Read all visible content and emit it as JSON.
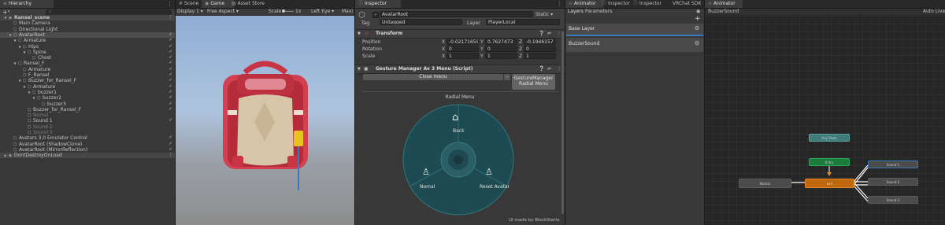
{
  "hierarchy": {
    "tab": "Hierarchy",
    "add": "+",
    "items": [
      {
        "label": "Ransel_scene",
        "icon": "◈",
        "check": "",
        "muted": false,
        "bold": true,
        "arrow": "▼",
        "indent": 0
      },
      {
        "label": "Main Camera",
        "icon": "⬡",
        "check": "",
        "muted": false,
        "bold": false,
        "arrow": "",
        "indent": 1
      },
      {
        "label": "Directional Light",
        "icon": "⬡",
        "check": "",
        "muted": false,
        "bold": false,
        "arrow": "",
        "indent": 1
      },
      {
        "label": "AvatarRoot",
        "icon": "⬡",
        "check": "✓",
        "muted": false,
        "bold": false,
        "arrow": "▼",
        "indent": 1,
        "selected": true
      },
      {
        "label": "Armature",
        "icon": "⬡",
        "check": "✓",
        "muted": false,
        "bold": false,
        "arrow": "▼",
        "indent": 2
      },
      {
        "label": "Hips",
        "icon": "⬡",
        "check": "✓",
        "muted": false,
        "bold": false,
        "arrow": "▼",
        "indent": 3
      },
      {
        "label": "Spine",
        "icon": "⬡",
        "check": "✓",
        "muted": false,
        "bold": false,
        "arrow": "▼",
        "indent": 4
      },
      {
        "label": "Chest",
        "icon": "⬡",
        "check": "✓",
        "muted": false,
        "bold": false,
        "arrow": "",
        "indent": 5
      },
      {
        "label": "Ransel_F",
        "icon": "⬡",
        "check": "✓",
        "muted": false,
        "bold": false,
        "arrow": "▼",
        "indent": 2
      },
      {
        "label": "Armature",
        "icon": "⬡",
        "check": "✓",
        "muted": false,
        "bold": false,
        "arrow": "",
        "indent": 3
      },
      {
        "label": "F_Ransel",
        "icon": "⬡",
        "check": "✓",
        "muted": false,
        "bold": false,
        "arrow": "",
        "indent": 3
      },
      {
        "label": "Buzzer_for_Ransel_F",
        "icon": "⬡",
        "check": "✓",
        "muted": false,
        "bold": false,
        "arrow": "▼",
        "indent": 3
      },
      {
        "label": "Armature",
        "icon": "⬡",
        "check": "✓",
        "muted": false,
        "bold": false,
        "arrow": "▼",
        "indent": 4
      },
      {
        "label": "buzzer1",
        "icon": "⬡",
        "check": "✓",
        "muted": false,
        "bold": false,
        "arrow": "▼",
        "indent": 5
      },
      {
        "label": "buzzer2",
        "icon": "⬡",
        "check": "✓",
        "muted": false,
        "bold": false,
        "arrow": "▼",
        "indent": 6
      },
      {
        "label": "buzzer3",
        "icon": "⬡",
        "check": "✓",
        "muted": false,
        "bold": false,
        "arrow": "",
        "indent": 7
      },
      {
        "label": "Buzzer_for_Ransel_F",
        "icon": "⬡",
        "check": "✓",
        "muted": false,
        "bold": false,
        "arrow": "",
        "indent": 4
      },
      {
        "label": "Nomal",
        "icon": "⬡",
        "check": "",
        "muted": true,
        "bold": false,
        "arrow": "",
        "indent": 4
      },
      {
        "label": "Sound 1",
        "icon": "⬡",
        "check": "✓",
        "muted": false,
        "bold": false,
        "arrow": "",
        "indent": 4
      },
      {
        "label": "Sound 2",
        "icon": "⬡",
        "check": "",
        "muted": true,
        "bold": false,
        "arrow": "",
        "indent": 4
      },
      {
        "label": "Sound 3",
        "icon": "⬡",
        "check": "",
        "muted": true,
        "bold": false,
        "arrow": "",
        "indent": 4
      },
      {
        "label": "Avatars 3.0 Emulator Control",
        "icon": "⬡",
        "check": "✓",
        "muted": false,
        "bold": false,
        "arrow": "",
        "indent": 1
      },
      {
        "label": "AvatarRoot (ShadowClone)",
        "icon": "⬡",
        "check": "✓",
        "muted": false,
        "bold": false,
        "arrow": "",
        "indent": 1
      },
      {
        "label": "AvatarRoot (MirrorReflection)",
        "icon": "⬡",
        "check": "✓",
        "muted": false,
        "bold": false,
        "arrow": "",
        "indent": 1
      },
      {
        "label": "DontDestroyOnLoad",
        "icon": "◈",
        "check": "",
        "muted": false,
        "bold": false,
        "arrow": "▶",
        "indent": 0
      }
    ]
  },
  "game": {
    "tabs": [
      "Scene",
      "Game",
      "Asset Store"
    ],
    "display": "Display 1",
    "aspect": "Free Aspect",
    "scale_label": "Scale",
    "scale_value": "1x",
    "eye": "Left Eye",
    "maximize": "Maxi"
  },
  "inspector": {
    "tab": "Inspector",
    "object_name": "AvatarRoot",
    "static_label": "Static",
    "tag_label": "Tag",
    "tag_value": "Untagged",
    "layer_label": "Layer",
    "layer_value": "PlayerLocal",
    "transform_title": "Transform",
    "rows": [
      {
        "label": "Position",
        "x": "-0.02171659",
        "y": "0.7627473",
        "z": "-0.1946157"
      },
      {
        "label": "Rotation",
        "x": "0",
        "y": "0",
        "z": "0"
      },
      {
        "label": "Scale",
        "x": "1",
        "y": "1",
        "z": "1"
      }
    ],
    "axis": {
      "x": "X",
      "y": "Y",
      "z": "Z"
    },
    "component_title": "Gesture Manager Av 3 Menu (Script)",
    "close_menu": "Close menu",
    "minus": "-",
    "gm_button_line1": "GestureManager",
    "gm_button_line2": "Radial Menu",
    "radial_title": "Radial Menu",
    "radial_back": "Back",
    "radial_nomal": "Nomal",
    "radial_reset": "Reset Avatar",
    "credit": "UI made by BlackStartx"
  },
  "animator": {
    "tabs": [
      "Animator",
      "Inspector",
      "Inspector",
      "VRChat SDK"
    ],
    "subtabs": [
      "Layers",
      "Parameters"
    ],
    "layers": [
      "Base Layer",
      "BuzzerSound"
    ],
    "plus": "+"
  },
  "graph": {
    "tab": "Animator",
    "breadcrumb": "BuzzerSound",
    "auto_live": "Auto Live",
    "nodes": {
      "any_state": "Any State",
      "entry": "Entry",
      "nomal": "Nomal",
      "exit": "exit",
      "sound1": "Sound 1",
      "sound2": "Sound 2",
      "sound3": "Sound 3"
    }
  },
  "colors": {
    "accent_blue": "#3a79bb",
    "radial_teal": "#1e4b52",
    "entry_green": "#1b7b3d",
    "any_state_teal": "#3f7b78",
    "active_orange": "#c0660c"
  }
}
